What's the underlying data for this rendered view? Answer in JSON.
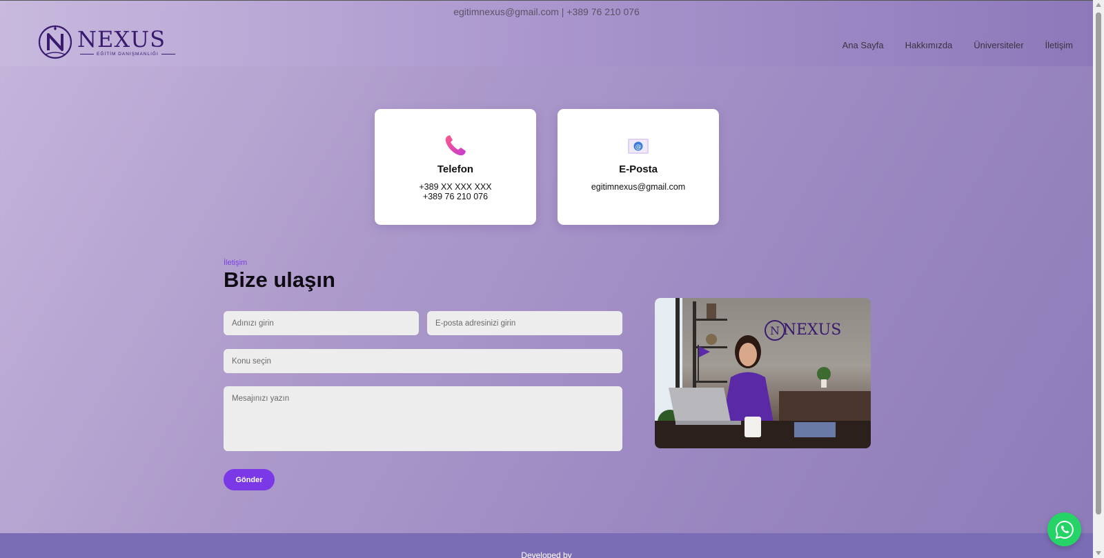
{
  "header": {
    "contact_line": "egitimnexus@gmail.com | +389 76 210 076",
    "logo": {
      "name": "NEXUS",
      "subtitle": "EĞİTİM DANIŞMANLIĞI",
      "icon": "nexus-logo-icon"
    },
    "nav": [
      {
        "label": "Ana Sayfa"
      },
      {
        "label": "Hakkımızda"
      },
      {
        "label": "Üniversiteler"
      },
      {
        "label": "İletişim"
      }
    ]
  },
  "cards": {
    "phone": {
      "icon": "phone-icon",
      "title": "Telefon",
      "line1": "+389 XX XXX XXX",
      "line2": "+389 76 210 076"
    },
    "email": {
      "icon": "email-icon",
      "title": "E-Posta",
      "line1": "egitimnexus@gmail.com"
    }
  },
  "contact": {
    "kicker": "İletişim",
    "heading": "Bize ulaşın",
    "name_placeholder": "Adınızı girin",
    "email_placeholder": "E-posta adresinizi girin",
    "subject_placeholder": "Konu seçin",
    "message_placeholder": "Mesajınızı yazın",
    "submit_label": "Gönder"
  },
  "footer": {
    "text": "Developed by"
  },
  "colors": {
    "accent": "#7b38e6",
    "brand": "#3a1a6e",
    "whatsapp": "#25d366",
    "footer": "#7b6db5"
  }
}
